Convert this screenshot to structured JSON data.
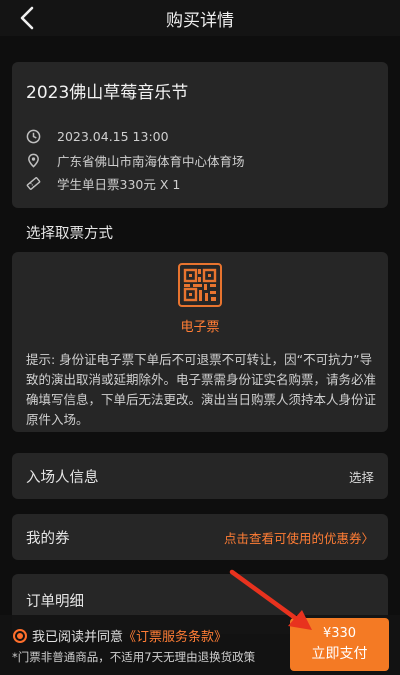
{
  "header": {
    "title": "购买详情"
  },
  "event": {
    "title": "2023佛山草莓音乐节",
    "datetime": "2023.04.15 13:00",
    "venue": "广东省佛山市南海体育中心体育场",
    "ticket": "学生单日票330元 X 1"
  },
  "pickup": {
    "section_label": "选择取票方式",
    "method_label": "电子票",
    "notice": "提示: 身份证电子票下单后不可退票不可转让，因“不可抗力”导致的演出取消或延期除外。电子票需身份证实名购票，请务必准确填写信息，下单后无法更改。演出当日购票人须持本人身份证原件入场。"
  },
  "attendee": {
    "title": "入场人信息",
    "action": "选择"
  },
  "coupon": {
    "title": "我的券",
    "link": "点击查看可使用的优惠券〉"
  },
  "order_detail": {
    "title": "订单明细"
  },
  "footer": {
    "agree_prefix": "我已阅读并同意",
    "agree_link": "《订票服务条款》",
    "disclaimer": "*门票非普通商品，不适用7天无理由退换货政策",
    "price": "¥330",
    "pay_label": "立即支付"
  },
  "colors": {
    "accent": "#ff7d35",
    "pay_button": "#f47a24",
    "annotation_arrow": "#e8321e"
  }
}
